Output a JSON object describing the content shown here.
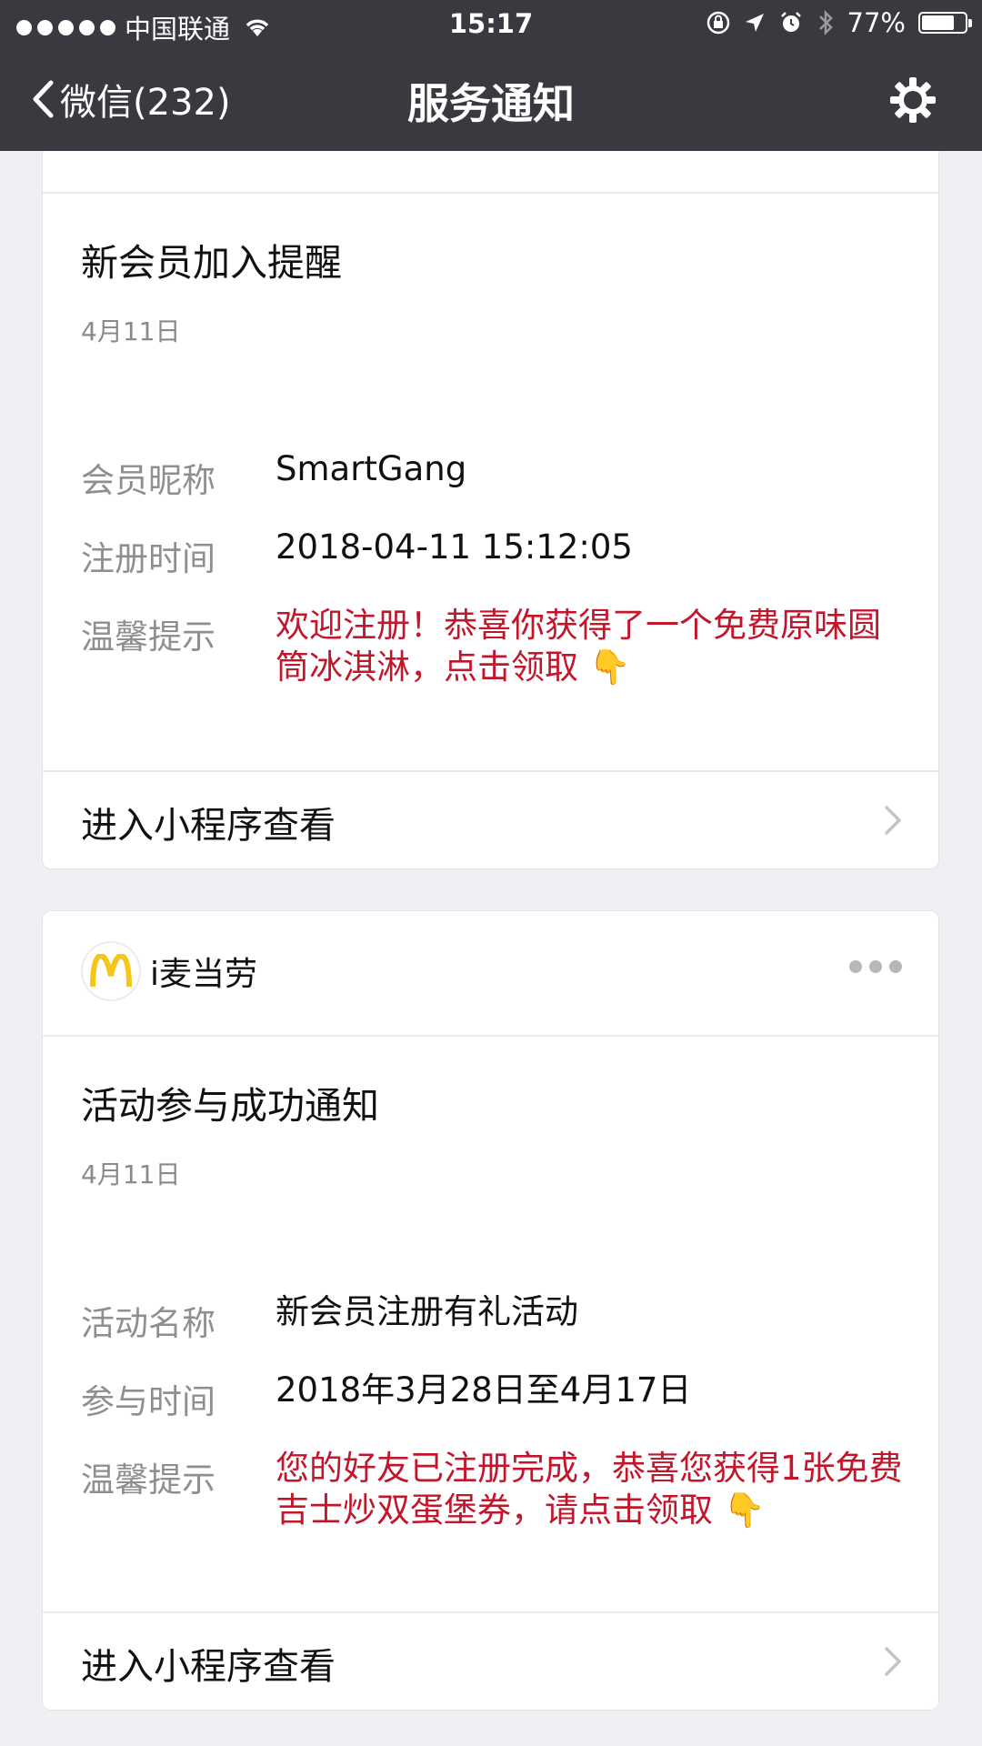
{
  "status_bar": {
    "carrier": "中国联通",
    "time": "15:17",
    "battery": "77%",
    "battery_level": 0.77,
    "icons": [
      "signal-dots",
      "wifi-icon",
      "orientation-lock-icon",
      "location-arrow-icon",
      "alarm-icon",
      "bluetooth-icon",
      "battery-icon"
    ]
  },
  "nav": {
    "back_label": "微信(232)",
    "title": "服务通知",
    "settings_icon": "gear-icon"
  },
  "cards": [
    {
      "title": "新会员加入提醒",
      "date": "4月11日",
      "fields": [
        {
          "label": "会员昵称",
          "value": "SmartGang"
        },
        {
          "label": "注册时间",
          "value": "2018-04-11 15:12:05"
        },
        {
          "label": "温馨提示",
          "value": "欢迎注册！恭喜你获得了一个免费原味圆筒冰淇淋，点击领取 👇"
        }
      ],
      "footer": "进入小程序查看"
    },
    {
      "brand": "i麦当劳",
      "title": "活动参与成功通知",
      "date": "4月11日",
      "fields": [
        {
          "label": "活动名称",
          "value": "新会员注册有礼活动"
        },
        {
          "label": "参与时间",
          "value": "2018年3月28日至4月17日"
        },
        {
          "label": "温馨提示",
          "value": "您的好友已注册完成，恭喜您获得1张免费吉士炒双蛋堡券，请点击领取 👇"
        }
      ],
      "footer": "进入小程序查看"
    }
  ],
  "colors": {
    "nav_bg": "#393a3f",
    "page_bg": "#efeff4",
    "highlight_red": "#c2162b",
    "label_gray": "#8f8f8f",
    "mcd_yellow": "#f5c518"
  }
}
